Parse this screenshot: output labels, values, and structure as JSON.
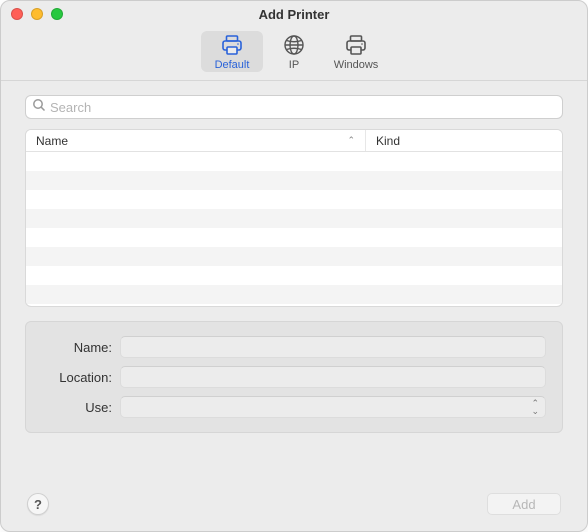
{
  "window": {
    "title": "Add Printer"
  },
  "tabs": [
    {
      "id": "default",
      "label": "Default",
      "selected": true
    },
    {
      "id": "ip",
      "label": "IP",
      "selected": false
    },
    {
      "id": "windows",
      "label": "Windows",
      "selected": false
    }
  ],
  "search": {
    "placeholder": "Search",
    "value": ""
  },
  "table": {
    "columns": [
      {
        "label": "Name",
        "sorted": "asc"
      },
      {
        "label": "Kind"
      }
    ],
    "rows": []
  },
  "form": {
    "name_label": "Name:",
    "name_value": "",
    "location_label": "Location:",
    "location_value": "",
    "use_label": "Use:",
    "use_value": ""
  },
  "footer": {
    "help_label": "?",
    "add_label": "Add",
    "add_enabled": false
  }
}
